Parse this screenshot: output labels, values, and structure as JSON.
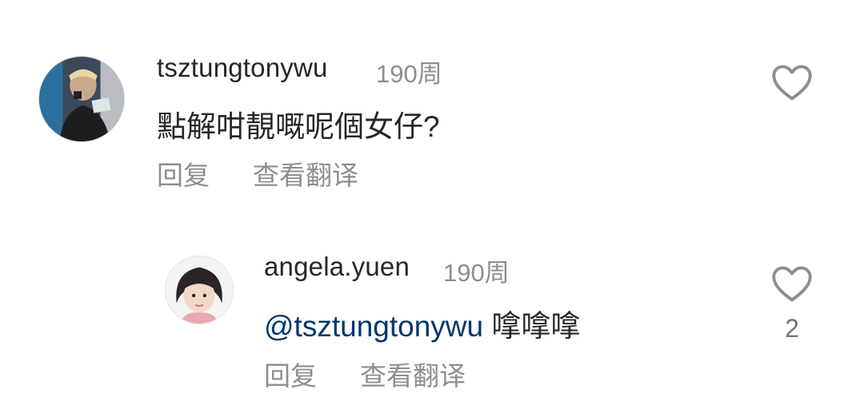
{
  "comments": [
    {
      "username": "tsztungtonywu",
      "time": "190周",
      "text": "點解咁靚嘅呢個女仔?",
      "reply_label": "回复",
      "translate_label": "查看翻译",
      "like_icon": "heart-outline-icon",
      "like_count": ""
    }
  ],
  "replies": [
    {
      "username": "angela.yuen",
      "time": "190周",
      "mention": "@tsztungtonywu",
      "text": "嗱嗱嗱",
      "reply_label": "回复",
      "translate_label": "查看翻译",
      "like_icon": "heart-outline-icon",
      "like_count": "2"
    }
  ],
  "colors": {
    "primary_text": "#262626",
    "secondary_text": "#8e8e8e",
    "mention": "#00376b",
    "heart_stroke": "#8e8e8e"
  }
}
